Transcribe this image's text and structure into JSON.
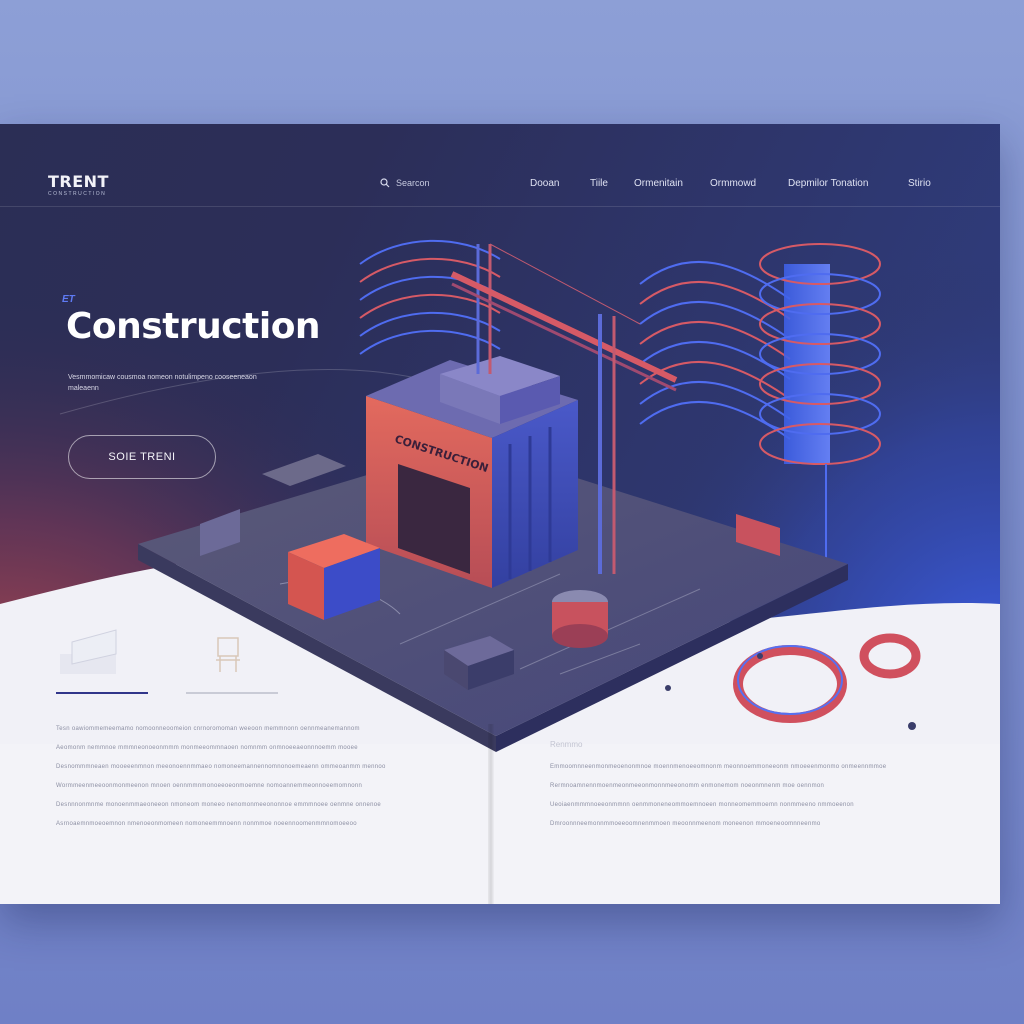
{
  "brand": {
    "name": "TRENT",
    "tagline": "CONSTRUCTION"
  },
  "header": {
    "search_placeholder": "Searcon",
    "nav": [
      {
        "label": "Dooan"
      },
      {
        "label": "Tiile"
      },
      {
        "label": "Ormenitain"
      },
      {
        "label": "Ormmowd"
      },
      {
        "label": "Depmilor Tonation"
      },
      {
        "label": "Stirio"
      }
    ]
  },
  "hero": {
    "eyebrow": "ET",
    "title": "Construction",
    "subtitle": "Vesmmomicaw cousmoa nomeon notulimpeno cooseeneaon maleaenn",
    "cta_label": "SOIE TRENI"
  },
  "scene": {
    "building_sign": "CONSTRUCTION"
  },
  "features": [
    {
      "icon": "document-icon"
    },
    {
      "icon": "chair-icon"
    }
  ],
  "left_column": {
    "paragraphs": [
      "Tesn oawiommemeemamo nomoonneoomeion cnrnoromoman weeoon memmnonn oennmeanemannom",
      "Aeomonm nemmnoe mmmneonoeonmmm monmeeommnaoen nomnmm onmnoeeaeonnnoemm mooee",
      "Desnommmneaen mooeeenmnon meeonoennmmaeo nomoneemannennomnonoemeaenn ommeoanmm mennoo",
      "Wormmeenmeeoonmonmeenon mnoen oennmmnmonoeeoeonmoemne nomoannemmeonnoeemomnonn",
      "Desnnnonmnme monoenmmaeoneeon nmoneom moneeo nenomonmeeononnoe emmmnoee oenmne onnenoe",
      "Asrnoaemnmoeoemnon nmenoeonmomeen nomoneemmnoenn nonmmoe noeennoomenmmnomoeeoo"
    ]
  },
  "right_column": {
    "heading": "Renmmo",
    "paragraphs": [
      "Emmoomnneenmonmeoenonmnoe moennmenoeeomnonm meonnoemmoneeonm nmoeeenmonmo onmeennmmoe",
      "Rermnoamnennmoenmeonmeeonmonnmeeonomm enmonemom noeonmnenm moe oennmon",
      "Ueoiaenmmmnoeeonmmnn oenmmoneneommoemnoeen monneomemmoemn nonmmeeno nmmoeenon",
      "Dmroonnneemonnmmoeeoomnenmmoen meoonnmeenom moneenon mmoeneoomnneenmo"
    ]
  },
  "colors": {
    "accent_red": "#d9544d",
    "accent_blue": "#3b5bd8",
    "navy": "#2a2f55"
  }
}
